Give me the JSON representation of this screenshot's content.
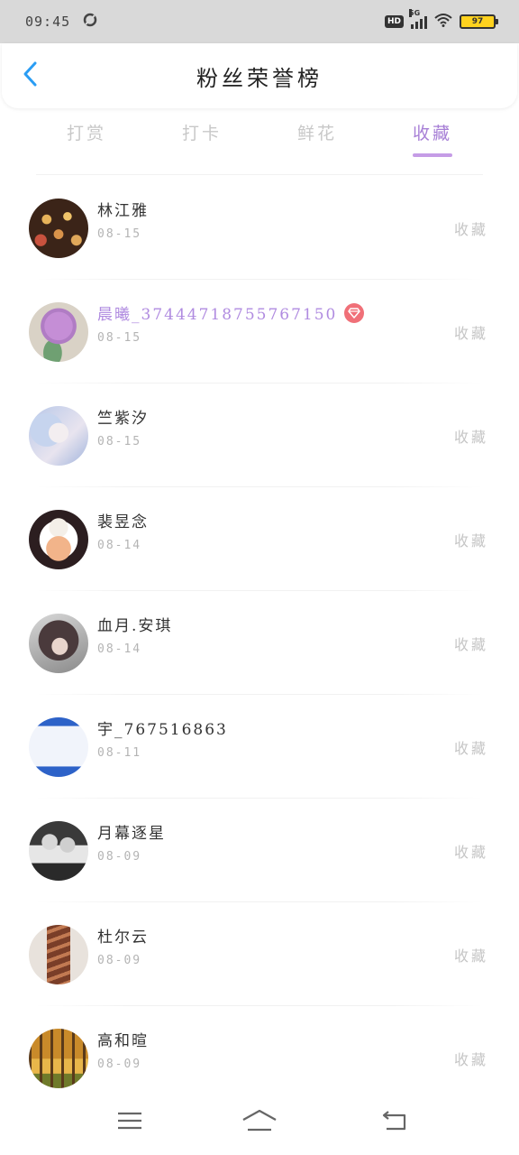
{
  "status_bar": {
    "time": "09:45",
    "network": "5G",
    "hd": "HD",
    "battery": "97"
  },
  "header": {
    "title": "粉丝荣誉榜",
    "back_icon": "chevron-left-icon"
  },
  "tabs": [
    {
      "label": "打赏",
      "active": false
    },
    {
      "label": "打卡",
      "active": false
    },
    {
      "label": "鲜花",
      "active": false
    },
    {
      "label": "收藏",
      "active": true
    }
  ],
  "colors": {
    "accent": "#a77fd6",
    "vip_badge": "#f07078",
    "muted": "#c6c6c6"
  },
  "fans": [
    {
      "name": "林江雅",
      "date": "08-15",
      "tag": "收藏",
      "vip": false
    },
    {
      "name": "晨曦_3744471875576715​0",
      "date": "08-15",
      "tag": "收藏",
      "vip": true
    },
    {
      "name": "竺紫汐",
      "date": "08-15",
      "tag": "收藏",
      "vip": false
    },
    {
      "name": "裴昱念",
      "date": "08-14",
      "tag": "收藏",
      "vip": false
    },
    {
      "name": "血月.安琪",
      "date": "08-14",
      "tag": "收藏",
      "vip": false
    },
    {
      "name": "宇_767516863",
      "date": "08-11",
      "tag": "收藏",
      "vip": false
    },
    {
      "name": "月幕逐星",
      "date": "08-09",
      "tag": "收藏",
      "vip": false
    },
    {
      "name": "杜尔云",
      "date": "08-09",
      "tag": "收藏",
      "vip": false
    },
    {
      "name": "高和暄",
      "date": "08-09",
      "tag": "收藏",
      "vip": false
    }
  ],
  "nav": {
    "menu_icon": "menu-icon",
    "home_icon": "home-icon",
    "back_icon": "back-arrow-icon"
  }
}
